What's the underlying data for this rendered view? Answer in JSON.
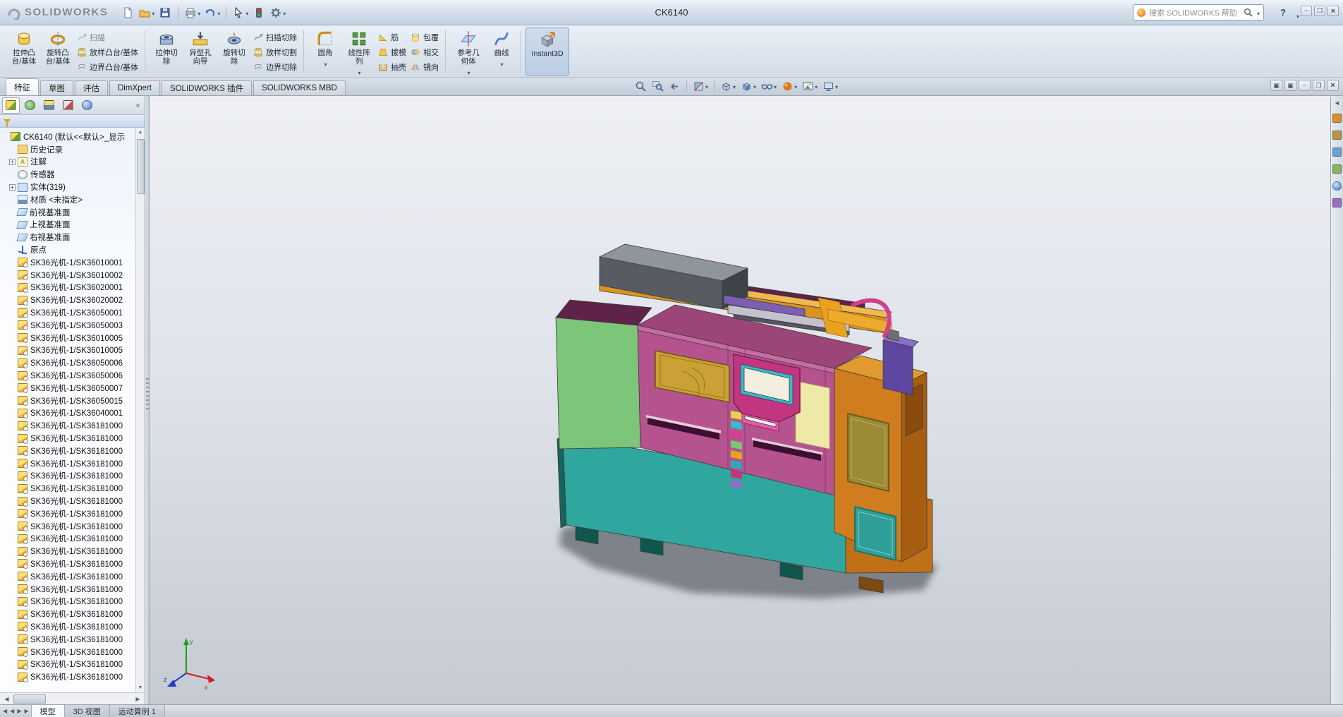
{
  "window": {
    "title": "CK6140"
  },
  "titlebar": {
    "logo": "SOLIDWORKS",
    "search_placeholder": "搜索 SOLIDWORKS 帮助",
    "help": "?"
  },
  "quick_toolbar_icons": [
    "new-document",
    "open",
    "save",
    "print",
    "undo",
    "select",
    "rebuild",
    "options"
  ],
  "ribbon": {
    "extrude_boss": "拉伸凸\n台/基体",
    "revolve_boss": "旋转凸\n台/基体",
    "sweep": "扫描",
    "loft_boss": "放样凸台/基体",
    "boundary_boss": "边界凸台/基体",
    "extrude_cut": "拉伸切\n除",
    "hole_wizard": "异型孔\n向导",
    "revolve_cut": "旋转切\n除",
    "sweep_cut": "扫描切除",
    "loft_cut": "放样切割",
    "boundary_cut": "边界切除",
    "fillet": "圆角",
    "linear_pattern": "线性阵\n列",
    "rib": "筋",
    "draft": "拔模",
    "shell": "抽壳",
    "wrap": "包覆",
    "intersect": "相交",
    "mirror": "镜向",
    "ref_geometry": "参考几\n何体",
    "curves": "曲线",
    "instant3d": "Instant3D"
  },
  "command_tabs": [
    {
      "label": "特征",
      "state": "active"
    },
    {
      "label": "草图",
      "state": ""
    },
    {
      "label": "评估",
      "state": ""
    },
    {
      "label": "DimXpert",
      "state": ""
    },
    {
      "label": "SOLIDWORKS 插件",
      "state": ""
    },
    {
      "label": "SOLIDWORKS MBD",
      "state": ""
    }
  ],
  "hud_icons": [
    "zoom-fit",
    "zoom-area",
    "previous-view",
    "section-view",
    "view-orientation",
    "display-style",
    "hide-show-items",
    "edit-appearance",
    "apply-scene",
    "view-settings"
  ],
  "left_panel": {
    "tabs": [
      "featuremanager",
      "propertymanager",
      "configurationmanager",
      "dimxpertmanager",
      "displaymanager"
    ]
  },
  "feature_tree": {
    "items": [
      {
        "label": "CK6140 (默认<<默认>_显示",
        "icon": "ti-root",
        "cls": "root",
        "exp": ""
      },
      {
        "label": "历史记录",
        "icon": "ti-history",
        "exp": ""
      },
      {
        "label": "注解",
        "icon": "ti-annotations",
        "exp": "+"
      },
      {
        "label": "传感器",
        "icon": "ti-sensors",
        "exp": ""
      },
      {
        "label": "实体(319)",
        "icon": "ti-bodies",
        "exp": "+"
      },
      {
        "label": "材质 <未指定>",
        "icon": "ti-material",
        "exp": ""
      },
      {
        "label": "前视基准面",
        "icon": "ti-plane",
        "exp": ""
      },
      {
        "label": "上视基准面",
        "icon": "ti-plane",
        "exp": ""
      },
      {
        "label": "右视基准面",
        "icon": "ti-plane",
        "exp": ""
      },
      {
        "label": "原点",
        "icon": "ti-origin",
        "exp": ""
      },
      {
        "label": "SK36光机-1/SK36010001",
        "icon": "ti-part",
        "exp": ""
      },
      {
        "label": "SK36光机-1/SK36010002",
        "icon": "ti-part",
        "exp": ""
      },
      {
        "label": "SK36光机-1/SK36020001",
        "icon": "ti-part",
        "exp": ""
      },
      {
        "label": "SK36光机-1/SK36020002",
        "icon": "ti-part",
        "exp": ""
      },
      {
        "label": "SK36光机-1/SK36050001",
        "icon": "ti-part",
        "exp": ""
      },
      {
        "label": "SK36光机-1/SK36050003",
        "icon": "ti-part",
        "exp": ""
      },
      {
        "label": "SK36光机-1/SK36010005",
        "icon": "ti-part",
        "exp": ""
      },
      {
        "label": "SK36光机-1/SK36010005",
        "icon": "ti-part",
        "exp": ""
      },
      {
        "label": "SK36光机-1/SK36050006",
        "icon": "ti-part",
        "exp": ""
      },
      {
        "label": "SK36光机-1/SK36050006",
        "icon": "ti-part",
        "exp": ""
      },
      {
        "label": "SK36光机-1/SK36050007",
        "icon": "ti-part",
        "exp": ""
      },
      {
        "label": "SK36光机-1/SK36050015",
        "icon": "ti-part",
        "exp": ""
      },
      {
        "label": "SK36光机-1/SK36040001",
        "icon": "ti-part",
        "exp": ""
      },
      {
        "label": "SK36光机-1/SK36181000",
        "icon": "ti-part",
        "exp": ""
      },
      {
        "label": "SK36光机-1/SK36181000",
        "icon": "ti-part",
        "exp": ""
      },
      {
        "label": "SK36光机-1/SK36181000",
        "icon": "ti-part",
        "exp": ""
      },
      {
        "label": "SK36光机-1/SK36181000",
        "icon": "ti-part",
        "exp": ""
      },
      {
        "label": "SK36光机-1/SK36181000",
        "icon": "ti-part",
        "exp": ""
      },
      {
        "label": "SK36光机-1/SK36181000",
        "icon": "ti-part",
        "exp": ""
      },
      {
        "label": "SK36光机-1/SK36181000",
        "icon": "ti-part",
        "exp": ""
      },
      {
        "label": "SK36光机-1/SK36181000",
        "icon": "ti-part",
        "exp": ""
      },
      {
        "label": "SK36光机-1/SK36181000",
        "icon": "ti-part",
        "exp": ""
      },
      {
        "label": "SK36光机-1/SK36181000",
        "icon": "ti-part",
        "exp": ""
      },
      {
        "label": "SK36光机-1/SK36181000",
        "icon": "ti-part",
        "exp": ""
      },
      {
        "label": "SK36光机-1/SK36181000",
        "icon": "ti-part",
        "exp": ""
      },
      {
        "label": "SK36光机-1/SK36181000",
        "icon": "ti-part",
        "exp": ""
      },
      {
        "label": "SK36光机-1/SK36181000",
        "icon": "ti-part",
        "exp": ""
      },
      {
        "label": "SK36光机-1/SK36181000",
        "icon": "ti-part",
        "exp": ""
      },
      {
        "label": "SK36光机-1/SK36181000",
        "icon": "ti-part",
        "exp": ""
      },
      {
        "label": "SK36光机-1/SK36181000",
        "icon": "ti-part",
        "exp": ""
      },
      {
        "label": "SK36光机-1/SK36181000",
        "icon": "ti-part",
        "exp": ""
      },
      {
        "label": "SK36光机-1/SK36181000",
        "icon": "ti-part",
        "exp": ""
      },
      {
        "label": "SK36光机-1/SK36181000",
        "icon": "ti-part",
        "exp": ""
      },
      {
        "label": "SK36光机-1/SK36181000",
        "icon": "ti-part",
        "exp": ""
      }
    ]
  },
  "bottom_tabs": [
    {
      "label": "模型",
      "state": "active"
    },
    {
      "label": "3D 视图",
      "state": ""
    },
    {
      "label": "运动算例 1",
      "state": ""
    }
  ],
  "task_pane_icons": [
    "solidworks-resources",
    "design-library",
    "file-explorer",
    "view-palette",
    "appearances",
    "custom-properties"
  ],
  "model_colors": {
    "base_teal": "#2FA79F",
    "body_magenta": "#B5538F",
    "panel_green": "#7CC579",
    "cabinet_orange": "#CF7D1E",
    "window_gold": "#C9A134",
    "pendant_pink": "#D6408E",
    "screen_cyan": "#39B9C9",
    "accent_purple": "#7A5FB2",
    "top_gray": "#575C63",
    "panel_cream": "#EFE9A8"
  }
}
